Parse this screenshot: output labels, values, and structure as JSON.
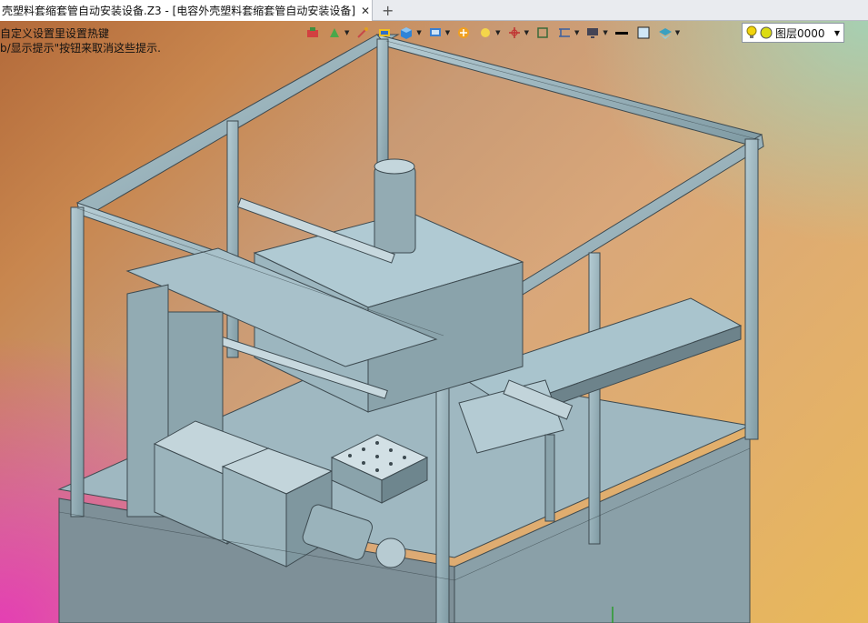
{
  "tab": {
    "title": "壳塑料套缩套管自动安装设备.Z3 - [电容外壳塑料套缩套管自动安装设备]",
    "close_glyph": "✕",
    "add_glyph": "+"
  },
  "hints": [
    "自定义设置里设置热键",
    "b/显示提示\"按钮来取消这些提示."
  ],
  "toolbar": {
    "icons": [
      "selection-filter-icon",
      "snap-icon",
      "pick-icon",
      "render-mode-icon",
      "view-cube-icon",
      "display-icon",
      "section-icon",
      "light-icon",
      "axis-icon",
      "frame-icon",
      "dimension-icon",
      "monitor-icon",
      "line-color-icon",
      "fill-color-icon",
      "layer-stack-icon"
    ]
  },
  "layer": {
    "label": "图层0000",
    "bulb_color": "#f2d40b",
    "dot_color": "#dcdc12"
  },
  "colors": {
    "frame": "#8ba0a8",
    "frame_dark": "#4d5e66",
    "machine": "#a7c3cd",
    "machine_dark": "#5b6f78",
    "accent_orange": "#e8a020",
    "accent_blue": "#2f6fc9"
  }
}
